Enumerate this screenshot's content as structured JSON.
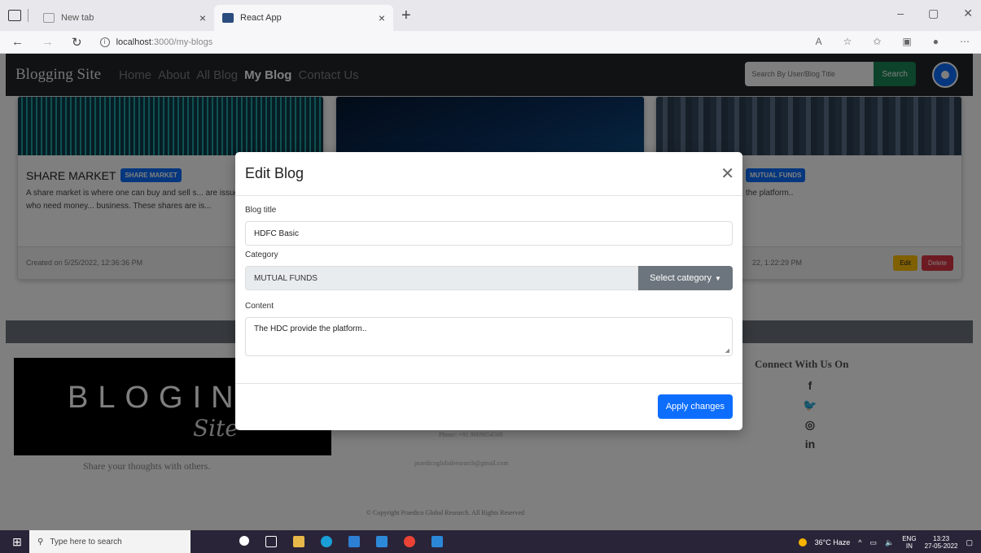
{
  "browser": {
    "tabs": [
      {
        "label": "New tab",
        "active": false
      },
      {
        "label": "React App",
        "active": true
      }
    ],
    "url_host": "localhost",
    "url_path": ":3000/my-blogs"
  },
  "navbar": {
    "brand": "Blogging Site",
    "links": [
      "Home",
      "About",
      "All Blog",
      "My Blog",
      "Contact Us"
    ],
    "active_link": "My Blog",
    "search_placeholder": "Search By User/Blog Title",
    "search_button": "Search"
  },
  "cards": [
    {
      "title": "SHARE MARKET",
      "badge": "SHARE MARKET",
      "text": "A share market is where one can buy and sell s... are issued by the companies who need money... business. These shares are is...",
      "created": "Created on 5/25/2022, 12:36:36 PM"
    },
    {
      "badge": "MUTUAL FUNDS",
      "text": "the platform..",
      "created": "22, 1:22:29 PM",
      "edit_label": "Edit",
      "delete_label": "Delete"
    }
  ],
  "footer": {
    "logo_word": "BLOGIN",
    "logo_script": "Site",
    "tagline": "Share your thoughts with others.",
    "phone": "Phone: +91 9009054508",
    "email": "praedicoglobalresearch@gmail.com",
    "connect_heading": "Connect With Us On",
    "social_icons": [
      "facebook-icon",
      "twitter-icon",
      "instagram-icon",
      "linkedin-icon"
    ],
    "copyright": "© Copyright Praedico Global Research. All Rights Reserved"
  },
  "modal": {
    "title": "Edit Blog",
    "title_label": "Blog title",
    "title_value": "HDFC Basic",
    "category_label": "Category",
    "category_value": "MUTUAL FUNDS",
    "category_button": "Select category",
    "content_label": "Content",
    "content_value": "The HDC provide the platform..",
    "apply_button": "Apply changes"
  },
  "taskbar": {
    "search_placeholder": "Type here to search",
    "weather": "36°C Haze",
    "lang": "ENG",
    "region": "IN",
    "time": "13:23",
    "date": "27-05-2022"
  }
}
